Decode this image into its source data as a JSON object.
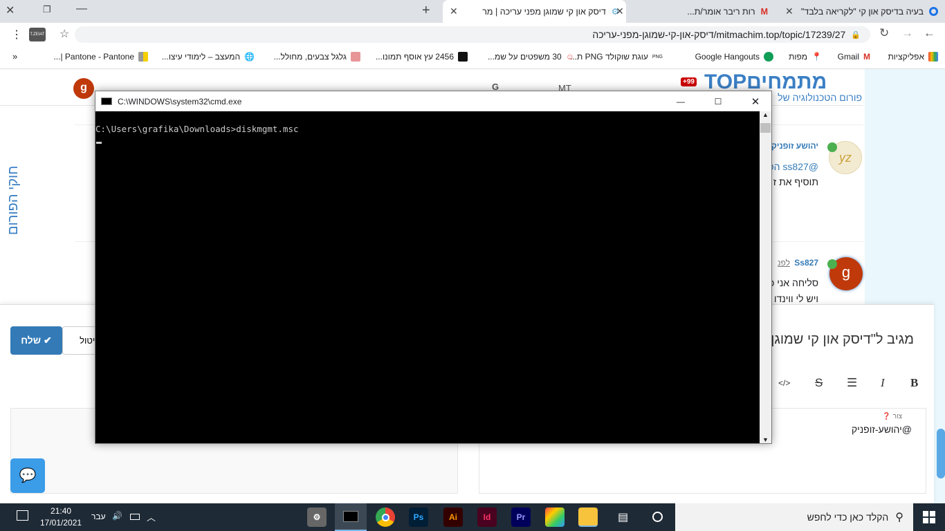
{
  "browser": {
    "tabs": [
      {
        "title": "בעיה בדיסק און קי \"לקריאה בלבד\"",
        "icon": "circle-icon"
      },
      {
        "title": "רות ריבר אומר/ת...",
        "icon": "gmail-icon"
      },
      {
        "title": "דיסק און קי שמוגן מפני עריכה | מר",
        "icon": "forum-icon",
        "active": true
      }
    ],
    "new_tab": "+",
    "url": "mitmachim.top/topic/17239/27/דיסק-און-קי-שמוגן-מפני-עריכה",
    "bookmarks": [
      "אפליקציות",
      "Gmail",
      "מפות",
      "Google Hangouts",
      "עוגת שוקולד PNG ת...",
      "30 משפטים על שמ...",
      "2456 עץ אוסף תמונו...",
      "גלגל צבעים, מחולל...",
      "המעצב – לימודי עיצו...",
      "Pantone - Pantone |..."
    ],
    "more_bookmarks": "»",
    "profile_label": "T.ZEIAT"
  },
  "forum": {
    "logo": "מתמחיםTOP",
    "tagline": "פורום הטכנולוגיה של",
    "notification_badge": "+99",
    "header_icons": [
      "G",
      "MT"
    ],
    "user_avatar": "g",
    "side_label": "חוקי הפורום",
    "posts": [
      {
        "author": "יהושע זופניק",
        "mention": "@ss827 הכ",
        "text": "תוסיף את ז",
        "avatar": "yz"
      },
      {
        "author": "Ss827",
        "time": "לפנ",
        "text1": "סליחה אני כ",
        "text2": "ויש לי ווינדו",
        "avatar": "g"
      }
    ],
    "composer": {
      "title": "מגיב ל\"דיסק און קי שמוגן",
      "submit": "שלח",
      "cancel": "ביטול",
      "toolbar": [
        "B",
        "I",
        "☰",
        "S",
        "</>"
      ],
      "help_label": "צור",
      "content": "@יהושע-זופניק"
    },
    "accent": "#337ab7"
  },
  "cmd": {
    "title": "C:\\WINDOWS\\system32\\cmd.exe",
    "line": "C:\\Users\\grafika\\Downloads>diskmgmt.msc"
  },
  "taskbar": {
    "search_placeholder": "הקלד כאן כדי לחפש",
    "time": "21:40",
    "date": "17/01/2021",
    "language": "עבר",
    "apps": [
      "Ps",
      "Ai",
      "Id",
      "Pr"
    ]
  }
}
